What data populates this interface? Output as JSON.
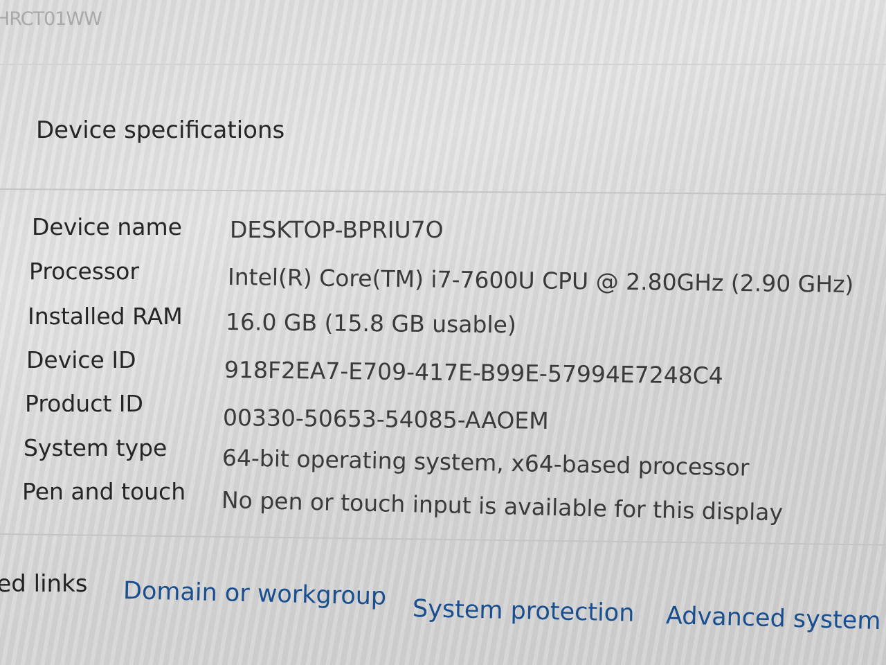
{
  "header": {
    "fragment": "HRCT01WW"
  },
  "device_specifications": {
    "title": "Device specifications",
    "rows": [
      {
        "label": "Device name",
        "value": "DESKTOP-BPRIU7O"
      },
      {
        "label": "Processor",
        "value": "Intel(R) Core(TM) i7-7600U CPU @ 2.80GHz (2.90 GHz)"
      },
      {
        "label": "Installed RAM",
        "value": "16.0 GB (15.8 GB usable)"
      },
      {
        "label": "Device ID",
        "value": "918F2EA7-E709-417E-B99E-57994E7248C4"
      },
      {
        "label": "Product ID",
        "value": "00330-50653-54085-AAOEM"
      },
      {
        "label": "System type",
        "value": "64-bit operating system, x64-based processor"
      },
      {
        "label": "Pen and touch",
        "value": "No pen or touch input is available for this display"
      }
    ]
  },
  "related_links": {
    "title": "ted links",
    "links": [
      {
        "label": "Domain or workgroup"
      },
      {
        "label": "System protection"
      },
      {
        "label": "Advanced system s"
      }
    ]
  },
  "colors": {
    "link": "#1a4f8f",
    "text": "#252525",
    "background": "#dcdcdc"
  }
}
